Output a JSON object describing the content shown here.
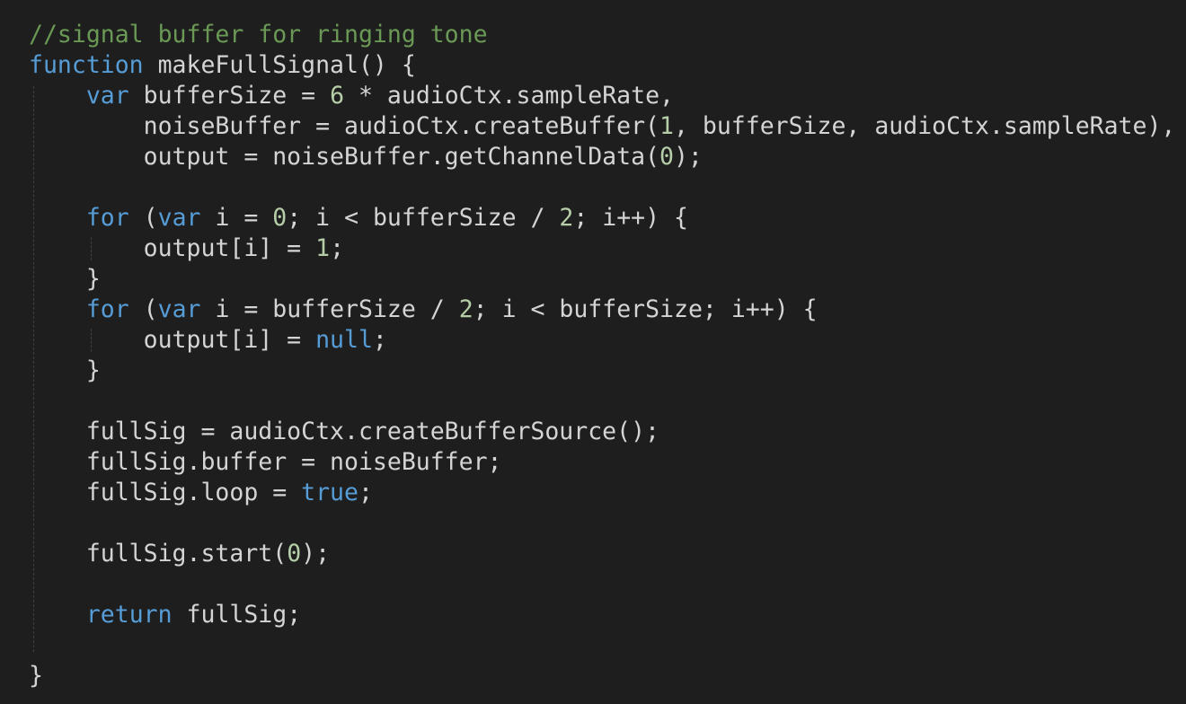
{
  "editor": {
    "theme": {
      "background": "#1e1e1e",
      "text": "#d4d4d4",
      "keyword": "#569cd6",
      "comment": "#6a9955",
      "number": "#b5cea8"
    },
    "lines": [
      [
        {
          "t": "comment",
          "v": "//signal buffer for ringing tone"
        }
      ],
      [
        {
          "t": "keyword",
          "v": "function"
        },
        {
          "t": "text",
          "v": " makeFullSignal() {"
        }
      ],
      [
        {
          "t": "text",
          "v": "    "
        },
        {
          "t": "keyword",
          "v": "var"
        },
        {
          "t": "text",
          "v": " bufferSize = "
        },
        {
          "t": "number",
          "v": "6"
        },
        {
          "t": "text",
          "v": " * audioCtx.sampleRate,"
        }
      ],
      [
        {
          "t": "text",
          "v": "        noiseBuffer = audioCtx.createBuffer("
        },
        {
          "t": "number",
          "v": "1"
        },
        {
          "t": "text",
          "v": ", bufferSize, audioCtx.sampleRate),"
        }
      ],
      [
        {
          "t": "text",
          "v": "        output = noiseBuffer.getChannelData("
        },
        {
          "t": "number",
          "v": "0"
        },
        {
          "t": "text",
          "v": ");"
        }
      ],
      [
        {
          "t": "text",
          "v": ""
        }
      ],
      [
        {
          "t": "text",
          "v": "    "
        },
        {
          "t": "keyword",
          "v": "for"
        },
        {
          "t": "text",
          "v": " ("
        },
        {
          "t": "keyword",
          "v": "var"
        },
        {
          "t": "text",
          "v": " i = "
        },
        {
          "t": "number",
          "v": "0"
        },
        {
          "t": "text",
          "v": "; i < bufferSize / "
        },
        {
          "t": "number",
          "v": "2"
        },
        {
          "t": "text",
          "v": "; i++) {"
        }
      ],
      [
        {
          "t": "text",
          "v": "        output[i] = "
        },
        {
          "t": "number",
          "v": "1"
        },
        {
          "t": "text",
          "v": ";"
        }
      ],
      [
        {
          "t": "text",
          "v": "    }"
        }
      ],
      [
        {
          "t": "text",
          "v": "    "
        },
        {
          "t": "keyword",
          "v": "for"
        },
        {
          "t": "text",
          "v": " ("
        },
        {
          "t": "keyword",
          "v": "var"
        },
        {
          "t": "text",
          "v": " i = bufferSize / "
        },
        {
          "t": "number",
          "v": "2"
        },
        {
          "t": "text",
          "v": "; i < bufferSize; i++) {"
        }
      ],
      [
        {
          "t": "text",
          "v": "        output[i] = "
        },
        {
          "t": "keyword",
          "v": "null"
        },
        {
          "t": "text",
          "v": ";"
        }
      ],
      [
        {
          "t": "text",
          "v": "    }"
        }
      ],
      [
        {
          "t": "text",
          "v": ""
        }
      ],
      [
        {
          "t": "text",
          "v": "    fullSig = audioCtx.createBufferSource();"
        }
      ],
      [
        {
          "t": "text",
          "v": "    fullSig.buffer = noiseBuffer;"
        }
      ],
      [
        {
          "t": "text",
          "v": "    fullSig.loop = "
        },
        {
          "t": "keyword",
          "v": "true"
        },
        {
          "t": "text",
          "v": ";"
        }
      ],
      [
        {
          "t": "text",
          "v": ""
        }
      ],
      [
        {
          "t": "text",
          "v": "    fullSig.start("
        },
        {
          "t": "number",
          "v": "0"
        },
        {
          "t": "text",
          "v": ");"
        }
      ],
      [
        {
          "t": "text",
          "v": ""
        }
      ],
      [
        {
          "t": "text",
          "v": "    "
        },
        {
          "t": "keyword",
          "v": "return"
        },
        {
          "t": "text",
          "v": " fullSig;"
        }
      ],
      [
        {
          "t": "text",
          "v": ""
        }
      ],
      [
        {
          "t": "text",
          "v": "}"
        }
      ]
    ]
  }
}
